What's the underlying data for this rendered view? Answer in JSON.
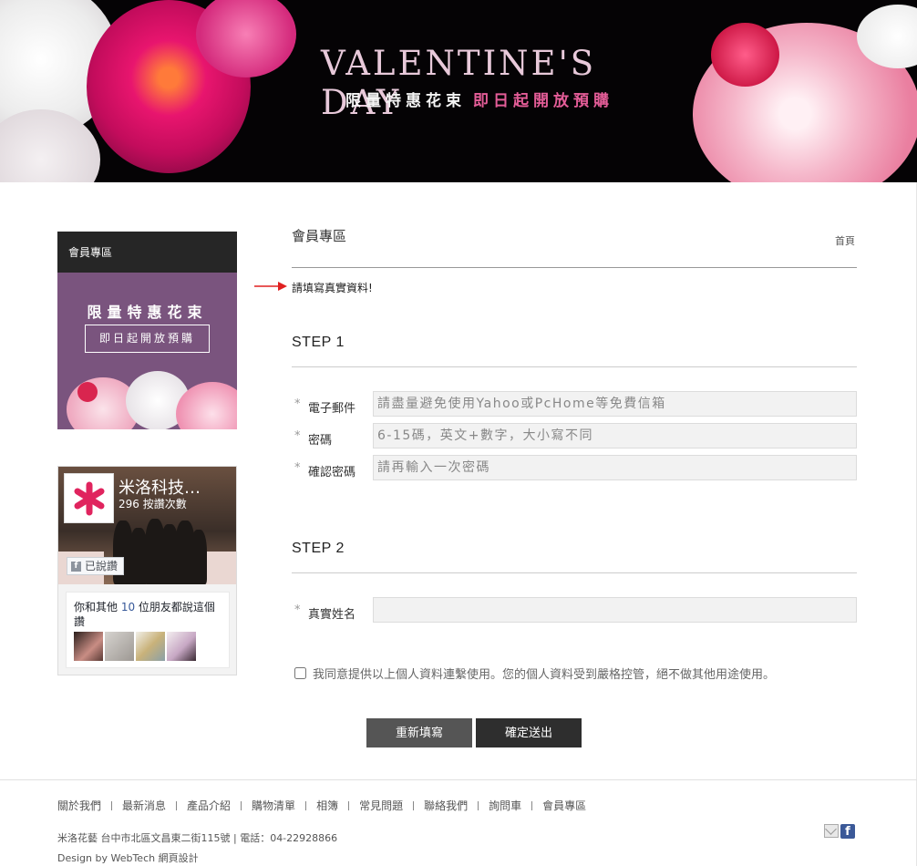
{
  "banner": {
    "title": "VALENTINE'S DAY",
    "sub_white": "限量特惠花束",
    "sub_pink": "即日起開放預購"
  },
  "sidebar": {
    "header": "會員專區",
    "ad_title": "限量特惠花束",
    "ad_box": "即日起開放預購",
    "fb": {
      "page_name": "米洛科技…",
      "likes": "296 按讚次數",
      "liked_label": "已說讚",
      "friends_pre": "你和其他 ",
      "friends_count": "10",
      "friends_post": " 位朋友都說這個讚"
    }
  },
  "main": {
    "title": "會員專區",
    "home_link": "首頁",
    "note": "請填寫真實資料!",
    "step1": "STEP 1",
    "step2": "STEP 2",
    "fields": {
      "email": {
        "label": "電子郵件",
        "placeholder": "請盡量避免使用Yahoo或PcHome等免費信箱"
      },
      "password": {
        "label": "密碼",
        "placeholder": "6-15碼，英文+數字，大小寫不同"
      },
      "confirm": {
        "label": "確認密碼",
        "placeholder": "請再輸入一次密碼"
      },
      "name": {
        "label": "真實姓名",
        "placeholder": ""
      }
    },
    "required_mark": "*",
    "agree_text": "我同意提供以上個人資料連繫使用。您的個人資料受到嚴格控管，絕不做其他用途使用。",
    "reset_label": "重新填寫",
    "submit_label": "確定送出"
  },
  "footer": {
    "nav": [
      "關於我們",
      "最新消息",
      "產品介紹",
      "購物清單",
      "相簿",
      "常見問題",
      "聯絡我們",
      "詢問車",
      "會員專區"
    ],
    "address": "米洛花藝  台中市北區文昌東二街115號 | 電話：04-22928866",
    "design": "Design by WebTech 網頁設計"
  },
  "colors": {
    "accent_pink": "#e45d98",
    "ad_purple": "#7a547e",
    "fb_blue": "#3b5998"
  }
}
